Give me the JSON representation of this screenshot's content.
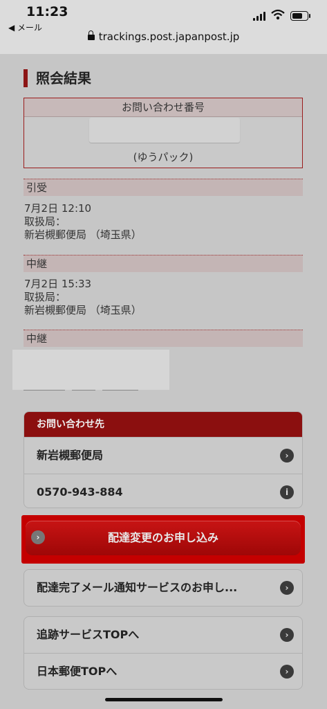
{
  "statusbar": {
    "time": "11:23",
    "back_label": "◀ メール",
    "url": "trackings.post.japanpost.jp"
  },
  "page": {
    "title": "照会結果",
    "inquiry": {
      "label": "お問い合わせ番号",
      "type": "(ゆうパック)"
    },
    "events": [
      {
        "status": "引受",
        "datetime": "7月2日 12:10",
        "office_label": "取扱局：",
        "office": "新岩槻郵便局 （埼玉県）"
      },
      {
        "status": "中継",
        "datetime": "7月2日 15:33",
        "office_label": "取扱局：",
        "office": "新岩槻郵便局 （埼玉県）"
      },
      {
        "status": "中継"
      }
    ],
    "contact": {
      "header": "お問い合わせ先",
      "office": "新岩槻郵便局",
      "phone": "0570-943-884"
    },
    "delivery_change_label": "配達変更のお申し込み",
    "mail_notify_label": "配達完了メール通知サービスのお申し...",
    "links": {
      "tracking_top": "追跡サービスTOPへ",
      "japanpost_top": "日本郵便TOPへ"
    }
  },
  "icons": {
    "chevron": "chevron-right-icon",
    "info": "info-icon"
  },
  "colors": {
    "accent": "#8b0f0f",
    "cta": "#c40000"
  }
}
